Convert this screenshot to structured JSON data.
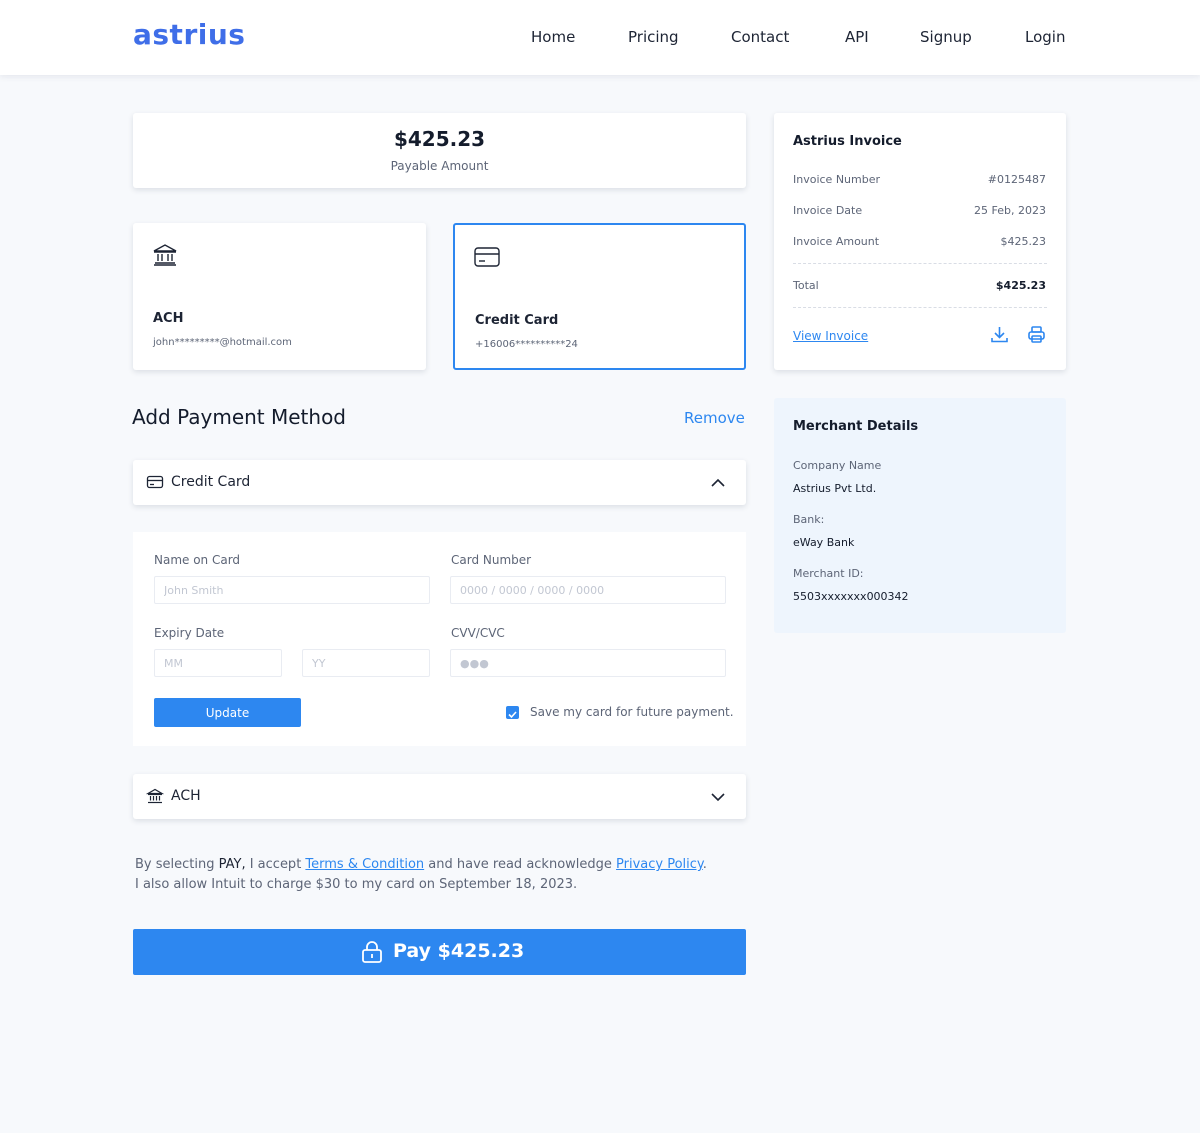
{
  "brand": {
    "logo": "astrius",
    "accent": "#2d87f0",
    "logo_color": "#3f6ee8"
  },
  "nav": {
    "home": "Home",
    "pricing": "Pricing",
    "contact": "Contact",
    "api": "API",
    "signup": "Signup",
    "login": "Login"
  },
  "amount": {
    "value": "$425.23",
    "label": "Payable Amount"
  },
  "methods": [
    {
      "icon": "bank-icon",
      "title": "ACH",
      "detail": "john*********@hotmail.com",
      "selected": false
    },
    {
      "icon": "credit-card-icon",
      "title": "Credit Card",
      "detail": "+16006**********24",
      "selected": true
    }
  ],
  "add_payment": {
    "title": "Add Payment Method",
    "remove_label": "Remove"
  },
  "credit_card_section": {
    "icon": "credit-card-icon",
    "title": "Credit Card",
    "expanded": true,
    "name_label": "Name on Card",
    "name_placeholder": "John Smith",
    "card_number_label": "Card Number",
    "card_number_placeholder": "0000 / 0000 / 0000 / 0000",
    "expiry_label": "Expiry Date",
    "month_placeholder": "MM",
    "year_placeholder": "YY",
    "cvv_label": "CVV/CVC",
    "cvv_placeholder": "●●●",
    "update_label": "Update",
    "save_card_label": "Save my card for future payment.",
    "save_card_checked": true
  },
  "ach_section": {
    "icon": "bank-icon",
    "title": "ACH",
    "expanded": false
  },
  "consent": {
    "part1": "By selecting ",
    "pay_word": "PAY,",
    "part2": " I accept ",
    "terms_link": "Terms & Condition",
    "part3": " and have read acknowledge ",
    "privacy_link": "Privacy Policy",
    "part4": ".",
    "line2": "I also allow Intuit to charge $30 to my card on September 18, 2023."
  },
  "pay_button": {
    "label": "Pay $425.23",
    "icon": "lock-icon"
  },
  "invoice": {
    "title": "Astrius Invoice",
    "rows": [
      {
        "label": "Invoice Number",
        "value": "#0125487"
      },
      {
        "label": "Invoice Date",
        "value": "25 Feb, 2023"
      },
      {
        "label": "Invoice Amount",
        "value": "$425.23"
      }
    ],
    "total_label": "Total",
    "total_value": "$425.23",
    "view_label": "View Invoice"
  },
  "merchant": {
    "title": "Merchant Details",
    "company_label": "Company Name",
    "company_value": "Astrius Pvt Ltd.",
    "bank_label": "Bank:",
    "bank_value": "eWay Bank",
    "merchant_id_label": "Merchant ID:",
    "merchant_id_value": "5503xxxxxxx000342"
  }
}
